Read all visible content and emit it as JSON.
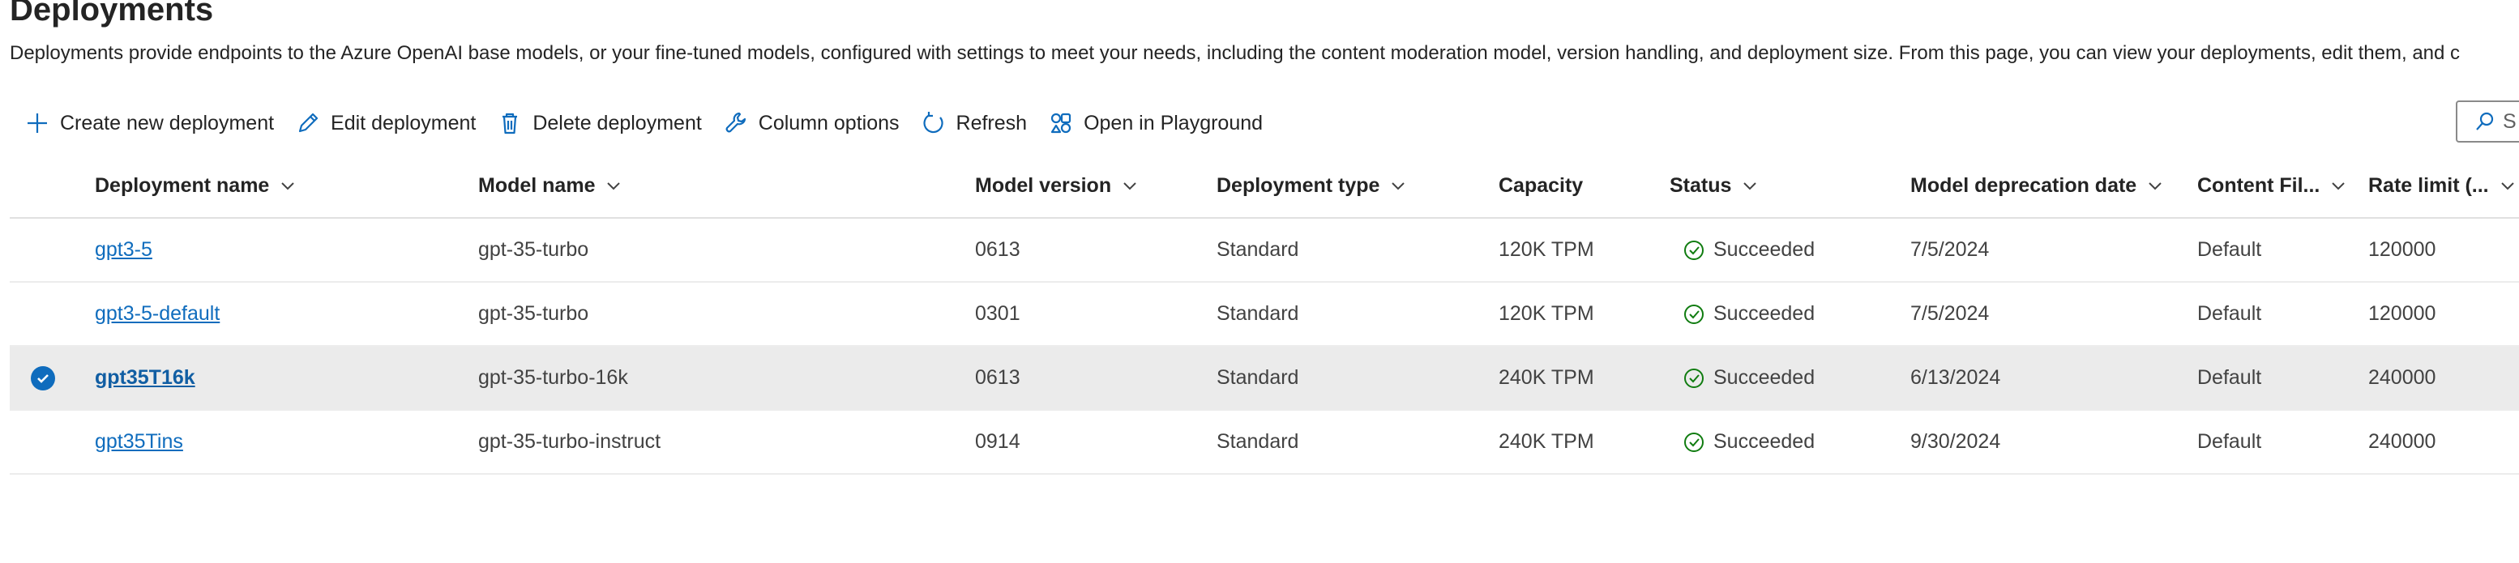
{
  "page": {
    "title": "Deployments",
    "description": "Deployments provide endpoints to the Azure OpenAI base models, or your fine-tuned models, configured with settings to meet your needs, including the content moderation model, version handling, and deployment size. From this page, you can view your deployments, edit them, and c"
  },
  "toolbar": {
    "create_label": "Create new deployment",
    "edit_label": "Edit deployment",
    "delete_label": "Delete deployment",
    "columns_label": "Column options",
    "refresh_label": "Refresh",
    "playground_label": "Open in Playground"
  },
  "search": {
    "placeholder": "S"
  },
  "table": {
    "headers": {
      "name": "Deployment name",
      "model": "Model name",
      "version": "Model version",
      "type": "Deployment type",
      "capacity": "Capacity",
      "status": "Status",
      "deprecation": "Model deprecation date",
      "content_filter": "Content Fil...",
      "rate_limit": "Rate limit (..."
    },
    "rows": [
      {
        "name": "gpt3-5",
        "model": "gpt-35-turbo",
        "version": "0613",
        "type": "Standard",
        "capacity": "120K TPM",
        "status": "Succeeded",
        "deprecation": "7/5/2024",
        "content_filter": "Default",
        "rate_limit": "120000",
        "selected": false
      },
      {
        "name": "gpt3-5-default",
        "model": "gpt-35-turbo",
        "version": "0301",
        "type": "Standard",
        "capacity": "120K TPM",
        "status": "Succeeded",
        "deprecation": "7/5/2024",
        "content_filter": "Default",
        "rate_limit": "120000",
        "selected": false
      },
      {
        "name": "gpt35T16k",
        "model": "gpt-35-turbo-16k",
        "version": "0613",
        "type": "Standard",
        "capacity": "240K TPM",
        "status": "Succeeded",
        "deprecation": "6/13/2024",
        "content_filter": "Default",
        "rate_limit": "240000",
        "selected": true
      },
      {
        "name": "gpt35Tins",
        "model": "gpt-35-turbo-instruct",
        "version": "0914",
        "type": "Standard",
        "capacity": "240K TPM",
        "status": "Succeeded",
        "deprecation": "9/30/2024",
        "content_filter": "Default",
        "rate_limit": "240000",
        "selected": false
      }
    ]
  },
  "colors": {
    "accent": "#0f6cbd",
    "success": "#107c10",
    "selected_row": "#ebebeb"
  },
  "icons": {
    "create": "add-icon",
    "edit": "pencil-icon",
    "delete": "trash-icon",
    "columns": "wrench-icon",
    "refresh": "refresh-icon",
    "playground": "playground-icon",
    "search": "search-icon",
    "status": "check-circle-icon",
    "selected": "checkmark-circle-icon"
  }
}
